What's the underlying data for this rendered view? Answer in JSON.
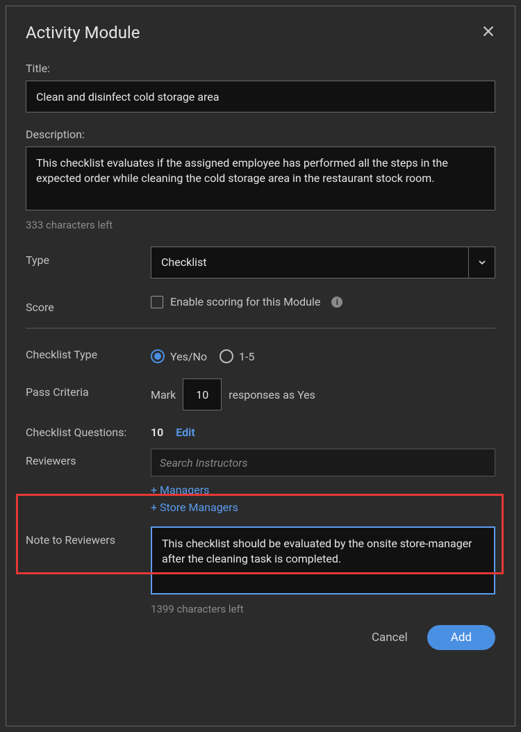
{
  "header": {
    "title": "Activity Module"
  },
  "title_field": {
    "label": "Title:",
    "value": "Clean and disinfect cold storage area"
  },
  "description_field": {
    "label": "Description:",
    "value": "This checklist evaluates if the assigned employee has performed all the steps in the expected order while cleaning the cold storage area in the restaurant stock room.",
    "helper": "333 characters left"
  },
  "type_row": {
    "label": "Type",
    "value": "Checklist"
  },
  "score_row": {
    "label": "Score",
    "checkbox_label": "Enable scoring for this Module"
  },
  "checklist_type_row": {
    "label": "Checklist Type",
    "opt1": "Yes/No",
    "opt2": "1-5"
  },
  "pass_criteria_row": {
    "label": "Pass Criteria",
    "prefix": "Mark",
    "value": "10",
    "suffix": "responses as Yes"
  },
  "checklist_questions_row": {
    "label": "Checklist Questions:",
    "count": "10",
    "edit": "Edit"
  },
  "reviewers_row": {
    "label": "Reviewers",
    "search_placeholder": "Search Instructors",
    "add1": "+ Managers",
    "add2": "+ Store Managers"
  },
  "note_row": {
    "label": "Note to Reviewers",
    "value": "This checklist should be evaluated by the onsite store-manager after the cleaning task is completed.",
    "helper": "1399 characters left"
  },
  "footer": {
    "cancel": "Cancel",
    "add": "Add"
  }
}
